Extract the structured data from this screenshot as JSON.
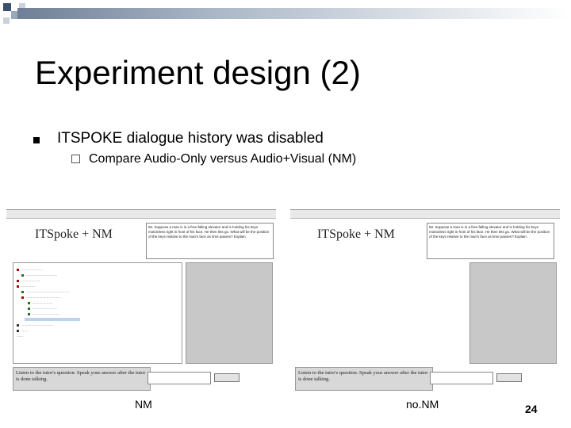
{
  "slide": {
    "title": "Experiment design (2)",
    "bullet": "ITSPOKE dialogue history was disabled",
    "sub_bullet": "Compare Audio-Only versus Audio+Visual (NM)",
    "caption_left": "NM",
    "caption_right": "no.NM",
    "page_number": "24"
  },
  "screens": {
    "left": {
      "brand": "ITSpoke + NM",
      "prompt": "Listen to the tutor's question. Speak your answer after the tutor is done talking.",
      "question": "50. Suppose a man is in a free-falling elevator and is holding his keys motionless right in front of his face. He then lets go. What will be the position of the keys relative to the man's face as time passes? Explain."
    },
    "right": {
      "brand": "ITSpoke + NM",
      "prompt": "Listen to the tutor's question. Speak your answer after the tutor is done talking.",
      "question": "50. Suppose a man is in a free-falling elevator and is holding his keys motionless right in front of his face. He then lets go. What will be the position of the keys relative to the man's face as time passes? Explain."
    }
  },
  "colors": {
    "bar_start": "#6e7f96",
    "deco_dark": "#3c4f6c",
    "deco_light": "#9aa8bc"
  }
}
